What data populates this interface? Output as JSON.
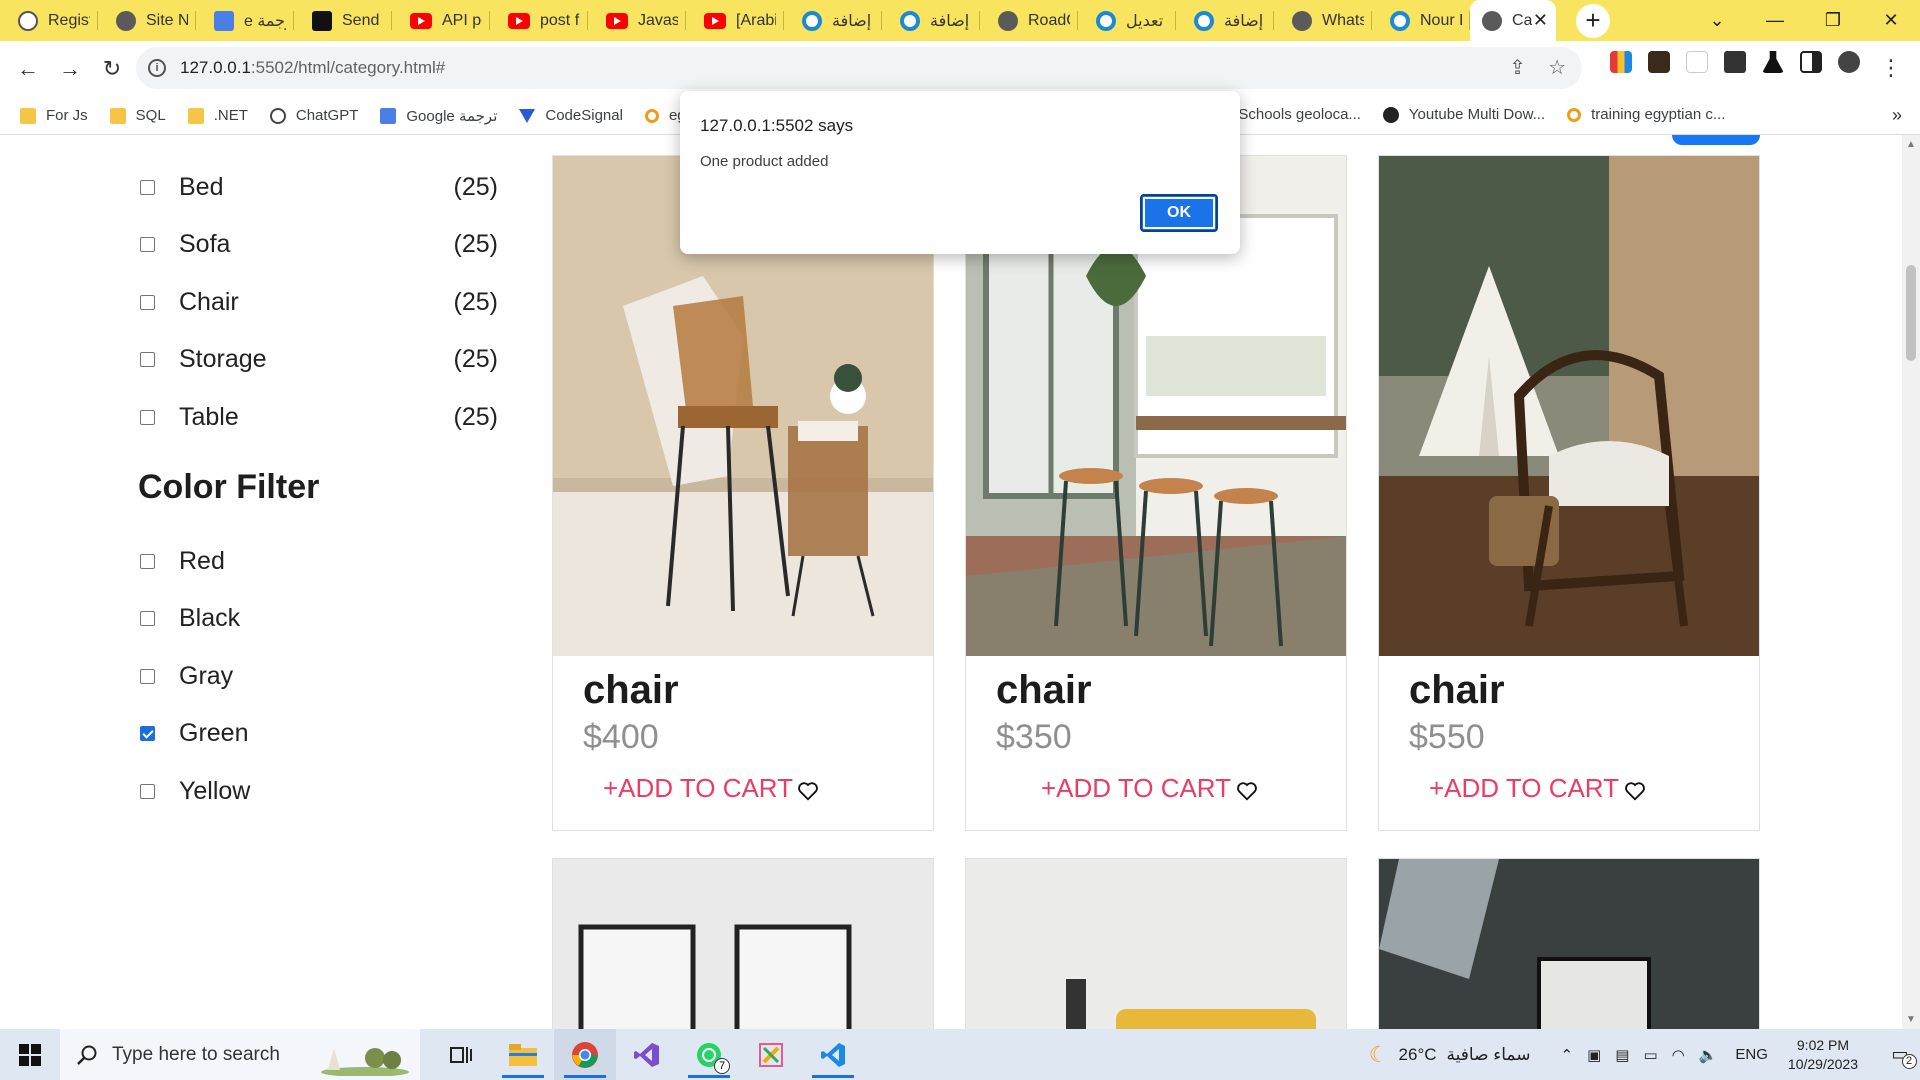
{
  "browser": {
    "tabs": [
      {
        "label": "Registr",
        "icon": "openai-icon"
      },
      {
        "label": "Site No",
        "icon": "globe-icon"
      },
      {
        "label": "e ترجمة",
        "icon": "google-translate-icon"
      },
      {
        "label": "Send In",
        "icon": "medium-icon"
      },
      {
        "label": "API pos",
        "icon": "youtube-icon"
      },
      {
        "label": "post fu",
        "icon": "youtube-icon"
      },
      {
        "label": "Javascr",
        "icon": "youtube-icon"
      },
      {
        "label": "[Arabic",
        "icon": "youtube-icon"
      },
      {
        "label": "إضافة",
        "icon": "ring-icon"
      },
      {
        "label": "إضافة",
        "icon": "ring-icon"
      },
      {
        "label": "RoadG",
        "icon": "globe-icon"
      },
      {
        "label": "تعديل",
        "icon": "ring-icon"
      },
      {
        "label": "إضافة",
        "icon": "ring-icon"
      },
      {
        "label": "WhatsA",
        "icon": "globe-icon"
      },
      {
        "label": "Nour E",
        "icon": "ring-icon"
      },
      {
        "label": "Ca",
        "icon": "globe-icon",
        "active": true
      }
    ],
    "new_tab": "+",
    "address": {
      "host": "127.0.0.1",
      "rest": ":5502/html/category.html#"
    },
    "bookmarks": [
      {
        "label": "For Js",
        "icon": "folder"
      },
      {
        "label": "SQL",
        "icon": "folder"
      },
      {
        "label": ".NET",
        "icon": "folder"
      },
      {
        "label": "ChatGPT",
        "icon": "gpt"
      },
      {
        "label": "Google ترجمة",
        "icon": "gt"
      },
      {
        "label": "CodeSignal",
        "icon": "cs"
      },
      {
        "label": "eg",
        "icon": "co"
      }
    ],
    "bookmarks_right": [
      {
        "label": "3Schools geoloca...",
        "icon": "none"
      },
      {
        "label": "Youtube Multi Dow...",
        "icon": "globe"
      },
      {
        "label": "training egyptian c...",
        "icon": "co"
      }
    ],
    "more": "»"
  },
  "sidebar": {
    "categories": [
      {
        "label": "Bed",
        "count": "(25)",
        "checked": false
      },
      {
        "label": "Sofa",
        "count": "(25)",
        "checked": false
      },
      {
        "label": "Chair",
        "count": "(25)",
        "checked": false
      },
      {
        "label": "Storage",
        "count": "(25)",
        "checked": false
      },
      {
        "label": "Table",
        "count": "(25)",
        "checked": false
      }
    ],
    "color_title": "Color Filter",
    "colors": [
      {
        "label": "Red",
        "checked": false
      },
      {
        "label": "Black",
        "checked": false
      },
      {
        "label": "Gray",
        "checked": false
      },
      {
        "label": "Green",
        "checked": true
      },
      {
        "label": "Yellow",
        "checked": false
      }
    ]
  },
  "products": [
    {
      "name": "chair",
      "price": "$400",
      "cart": "+ADD TO CART"
    },
    {
      "name": "chair",
      "price": "$350",
      "cart": "+ADD TO CART"
    },
    {
      "name": "chair",
      "price": "$550",
      "cart": "+ADD TO CART"
    }
  ],
  "alert": {
    "title": "127.0.0.1:5502 says",
    "message": "One product added",
    "ok": "OK"
  },
  "taskbar": {
    "search_placeholder": "Type here to search",
    "whatsapp_badge": "7",
    "weather_temp": "26°C",
    "weather_text": "سماء صافية",
    "lang": "ENG",
    "time": "9:02 PM",
    "date": "10/29/2023",
    "notif_count": "2"
  },
  "colors": {
    "tab_strip": "#f9e45f",
    "accent_cart": "#ec3c64",
    "ok_button": "#1a73e8",
    "checkbox_checked": "#1a6fdc"
  }
}
